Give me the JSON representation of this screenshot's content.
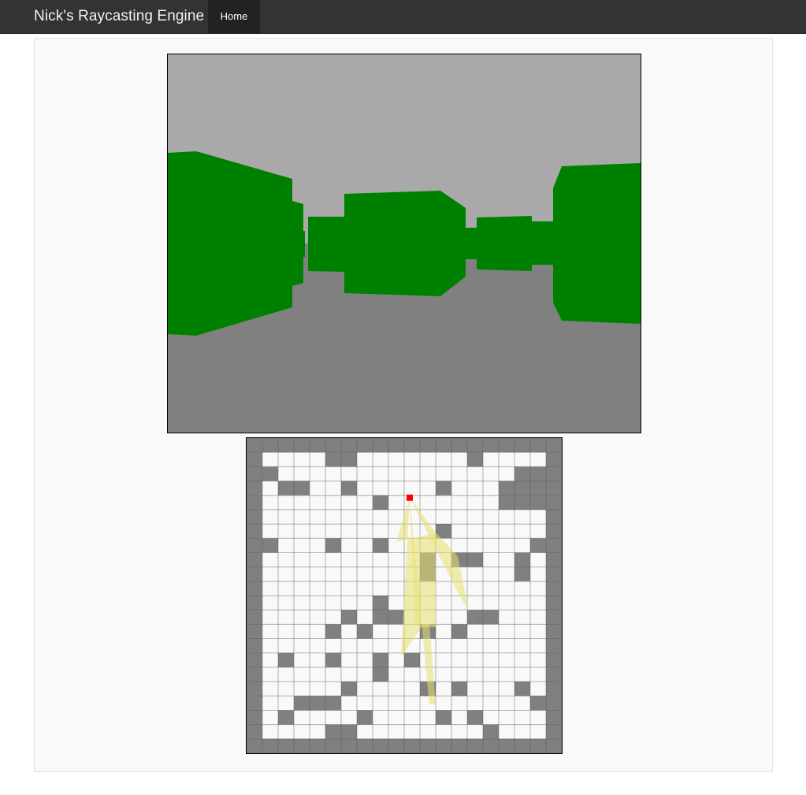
{
  "navbar": {
    "brand": "Nick's Raycasting Engine",
    "items": [
      {
        "label": "Home",
        "active": true
      }
    ]
  },
  "colors": {
    "ceiling": "#a9a9a9",
    "floor": "#808080",
    "wall": "#008000",
    "map_wall": "#808080",
    "map_floor": "#f9f9f9",
    "grid_line": "#555555",
    "player": "#ff0000",
    "ray": "#e8e070"
  },
  "map": {
    "rows": [
      "11111111111111111111",
      "10000110000000100001",
      "11000000000000000111",
      "10110010000010001111",
      "10000000100000001111",
      "10000000000000000001",
      "10000000000010000001",
      "11000100100000000011",
      "10000000000101100101",
      "10000000000100000101",
      "10000000000000000001",
      "10000000100000000001",
      "10000010110000110001",
      "10000101000101000001",
      "10000000000000000001",
      "10100100101000000001",
      "10000000100000000001",
      "10000010000101000101",
      "10011100000000000011",
      "10100001000010100001",
      "10000110000000010001",
      "11111111111111111111"
    ],
    "player": {
      "col": 10,
      "row": 4
    }
  }
}
